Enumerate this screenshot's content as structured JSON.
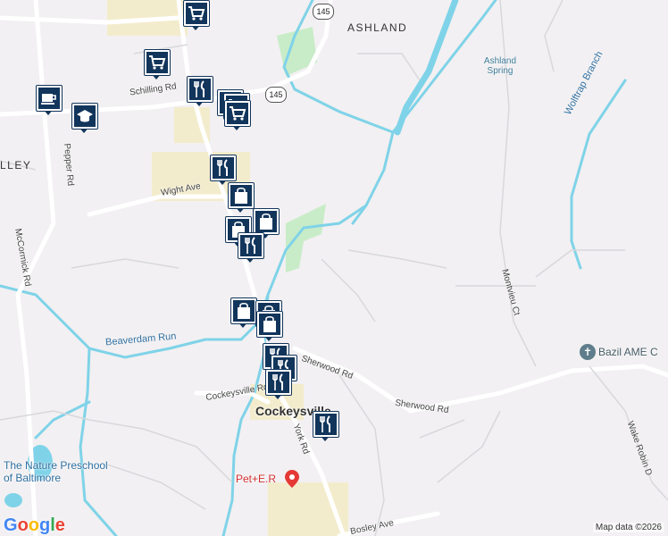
{
  "map": {
    "colors": {
      "background": "#f2f0f2",
      "water": "#7fd3e8",
      "park": "#c8ecc8",
      "commercial": "#f3eccc",
      "road": "#ffffff",
      "marker": "#12355b"
    },
    "labels": {
      "ashland": "ASHLAND",
      "ashland_spring": "Ashland Spring",
      "valley": "LLEY",
      "cockeysville": "Cockeysville",
      "wolftrap_branch": "Wolftrap Branch",
      "montvieu_ct": "Montvieu Ct",
      "bazil_ame": "Bazil AME C",
      "wight_ave": "Wight Ave",
      "schilling_rd": "Schilling Rd",
      "pepper_rd": "Pepper Rd",
      "mccormick_rd": "McCormick Rd",
      "beaverdam_run": "Beaverdam Run",
      "sherwood_rd_1": "Sherwood Rd",
      "sherwood_rd_2": "Sherwood Rd",
      "cockeysville_rd": "Cockeysville Rd",
      "york_rd": "York Rd",
      "nature_preschool": "The Nature Preschool of Baltimore",
      "pet_er": "Pet+E.R",
      "wake_robin": "Wake Robin D",
      "bosley_ave": "Bosley Ave"
    },
    "route_shields": [
      "145",
      "145"
    ],
    "markers": [
      {
        "icon": "shopping-cart-icon",
        "kind": "grocery"
      },
      {
        "icon": "shopping-cart-icon",
        "kind": "grocery"
      },
      {
        "icon": "coffee-cup-icon",
        "kind": "cafe"
      },
      {
        "icon": "graduation-cap-icon",
        "kind": "school"
      },
      {
        "icon": "fork-knife-icon",
        "kind": "restaurant"
      },
      {
        "icon": "fork-knife-icon",
        "kind": "restaurant"
      },
      {
        "icon": "shopping-cart-icon",
        "kind": "grocery"
      },
      {
        "icon": "shopping-cart-icon",
        "kind": "grocery"
      },
      {
        "icon": "fork-knife-icon",
        "kind": "restaurant"
      },
      {
        "icon": "shopping-bag-icon",
        "kind": "shop"
      },
      {
        "icon": "shopping-bag-icon",
        "kind": "shop"
      },
      {
        "icon": "shopping-bag-icon",
        "kind": "shop"
      },
      {
        "icon": "fork-knife-icon",
        "kind": "restaurant"
      },
      {
        "icon": "shopping-bag-icon",
        "kind": "shop"
      },
      {
        "icon": "shopping-bag-icon",
        "kind": "shop"
      },
      {
        "icon": "shopping-bag-icon",
        "kind": "shop"
      },
      {
        "icon": "fork-knife-icon",
        "kind": "restaurant"
      },
      {
        "icon": "fork-knife-icon",
        "kind": "restaurant"
      },
      {
        "icon": "fork-knife-icon",
        "kind": "restaurant"
      },
      {
        "icon": "fork-knife-icon",
        "kind": "restaurant"
      }
    ],
    "attribution": "Map data ©2026",
    "logo": "Google"
  }
}
